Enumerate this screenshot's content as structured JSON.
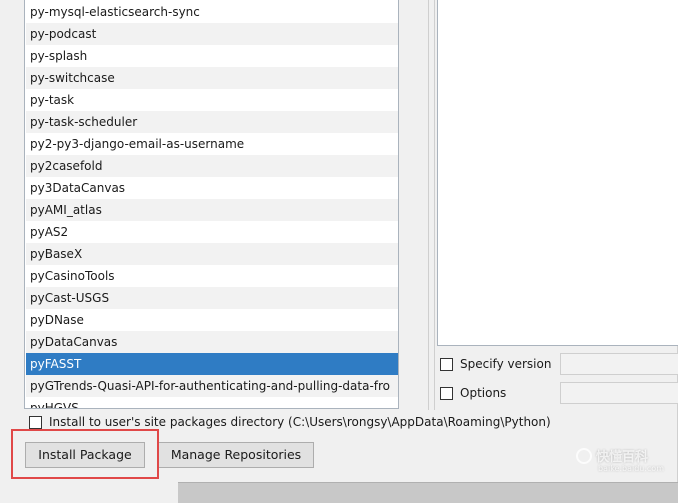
{
  "packages": [
    "py-mysql-elasticsearch-sync",
    "py-podcast",
    "py-splash",
    "py-switchcase",
    "py-task",
    "py-task-scheduler",
    "py2-py3-django-email-as-username",
    "py2casefold",
    "py3DataCanvas",
    "pyAMI_atlas",
    "pyAS2",
    "pyBaseX",
    "pyCasinoTools",
    "pyCast-USGS",
    "pyDNase",
    "pyDataCanvas",
    "pyFASST",
    "pyGTrends-Quasi-API-for-authenticating-and-pulling-data-fro",
    "pyHGVS"
  ],
  "selected_package": "pyFASST",
  "options": {
    "specify_version_label": "Specify version",
    "options_label": "Options"
  },
  "install_user_label": "Install to user's site packages directory (C:\\Users\\rongsy\\AppData\\Roaming\\Python)",
  "buttons": {
    "install_package": "Install Package",
    "manage_repositories": "Manage Repositories"
  },
  "watermark": {
    "main": "快懂百科",
    "sub": "baike.baidu.com"
  },
  "colors": {
    "selection": "#2f7cc4",
    "highlight_box": "#e04848"
  }
}
